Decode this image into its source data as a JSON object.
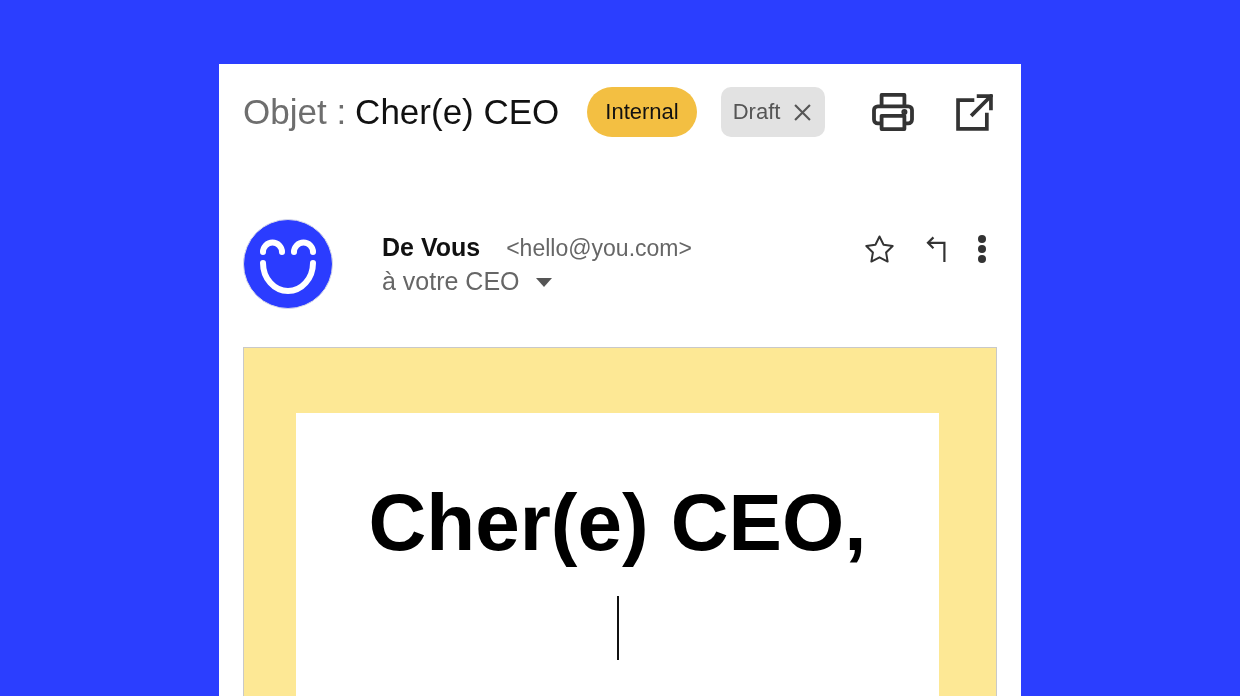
{
  "subject": {
    "label": "Objet :",
    "value": "Cher(e) CEO"
  },
  "tags": [
    {
      "label": "Internal",
      "kind": "label",
      "color": "#f3bf42"
    },
    {
      "label": "Draft",
      "kind": "removable",
      "color": "#e2e2e2"
    }
  ],
  "sender": {
    "name": "De Vous",
    "email": "<hello@you.com>",
    "recipient": "à votre CEO"
  },
  "letter": {
    "greeting": "Cher(e) CEO,"
  }
}
